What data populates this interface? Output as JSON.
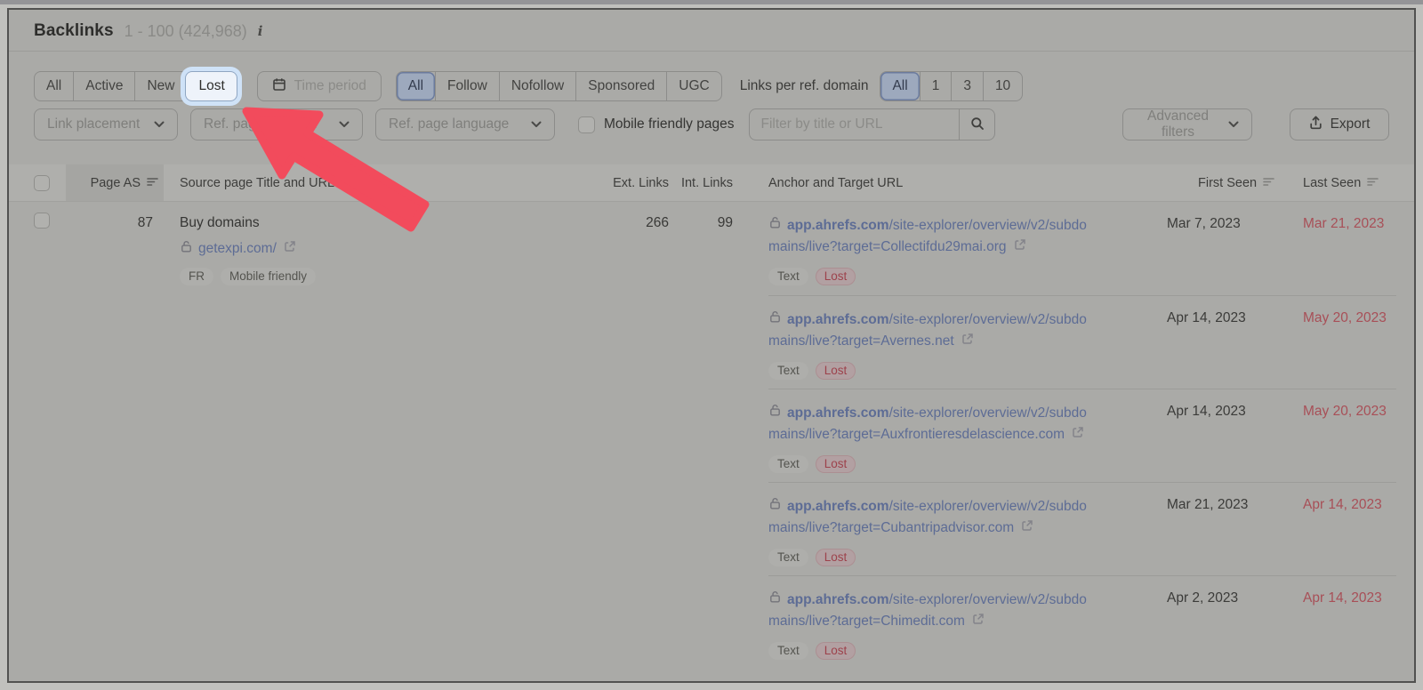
{
  "header": {
    "title": "Backlinks",
    "range_text": "1 - 100 (424,968)",
    "info_icon": "i"
  },
  "filters": {
    "status_tabs": [
      {
        "label": "All"
      },
      {
        "label": "Active"
      },
      {
        "label": "New"
      },
      {
        "label": "Lost",
        "highlighted": true
      }
    ],
    "time_period_label": "Time period",
    "follow_tabs": [
      {
        "label": "All",
        "selected": true
      },
      {
        "label": "Follow"
      },
      {
        "label": "Nofollow"
      },
      {
        "label": "Sponsored"
      },
      {
        "label": "UGC"
      }
    ],
    "links_per_domain_label": "Links per ref. domain",
    "links_per_domain_tabs": [
      {
        "label": "All",
        "selected": true
      },
      {
        "label": "1"
      },
      {
        "label": "3"
      },
      {
        "label": "10"
      }
    ],
    "link_placement_label": "Link placement",
    "ref_page_platform_label": "Ref. page platform",
    "ref_page_language_label": "Ref. page language",
    "mobile_friendly_label": "Mobile friendly pages",
    "mobile_friendly_checked": false,
    "search_placeholder": "Filter by title or URL",
    "advanced_filters_label": "Advanced filters",
    "export_label": "Export"
  },
  "table": {
    "columns": {
      "page_as": "Page AS",
      "source": "Source page Title and URL",
      "ext_links": "Ext. Links",
      "int_links": "Int. Links",
      "anchor": "Anchor and Target URL",
      "first_seen": "First Seen",
      "last_seen": "Last Seen"
    },
    "rows": [
      {
        "page_as": "87",
        "title": "Buy domains",
        "source_url": "getexpi.com/",
        "source_badges": [
          "FR",
          "Mobile friendly"
        ],
        "ext_links": "266",
        "int_links": "99",
        "anchor_host": "app.ahrefs.com",
        "anchor_line1": "/site-explorer/overview/v2/subdo",
        "anchor_line2": "mains/live?target=Collectifdu29mai.org",
        "badges": [
          "Text",
          "Lost"
        ],
        "first_seen": "Mar 7, 2023",
        "last_seen": "Mar 21, 2023"
      },
      {
        "anchor_host": "app.ahrefs.com",
        "anchor_line1": "/site-explorer/overview/v2/subdo",
        "anchor_line2": "mains/live?target=Avernes.net",
        "badges": [
          "Text",
          "Lost"
        ],
        "first_seen": "Apr 14, 2023",
        "last_seen": "May 20, 2023"
      },
      {
        "anchor_host": "app.ahrefs.com",
        "anchor_line1": "/site-explorer/overview/v2/subdo",
        "anchor_line2": "mains/live?target=Auxfrontieresdelascience.com",
        "badges": [
          "Text",
          "Lost"
        ],
        "first_seen": "Apr 14, 2023",
        "last_seen": "May 20, 2023"
      },
      {
        "anchor_host": "app.ahrefs.com",
        "anchor_line1": "/site-explorer/overview/v2/subdo",
        "anchor_line2": "mains/live?target=Cubantripadvisor.com",
        "badges": [
          "Text",
          "Lost"
        ],
        "first_seen": "Mar 21, 2023",
        "last_seen": "Apr 14, 2023"
      },
      {
        "anchor_host": "app.ahrefs.com",
        "anchor_line1": "/site-explorer/overview/v2/subdo",
        "anchor_line2": "mains/live?target=Chimedit.com",
        "badges": [
          "Text",
          "Lost"
        ],
        "first_seen": "Apr 2, 2023",
        "last_seen": "Apr 14, 2023"
      }
    ]
  },
  "colors": {
    "annotation_red": "#f24b5c",
    "link_blue": "#5d6c95",
    "lost_red": "#a84f57",
    "highlight_glow": "#cfe2f7",
    "selected_segment": "#9da9bd"
  }
}
